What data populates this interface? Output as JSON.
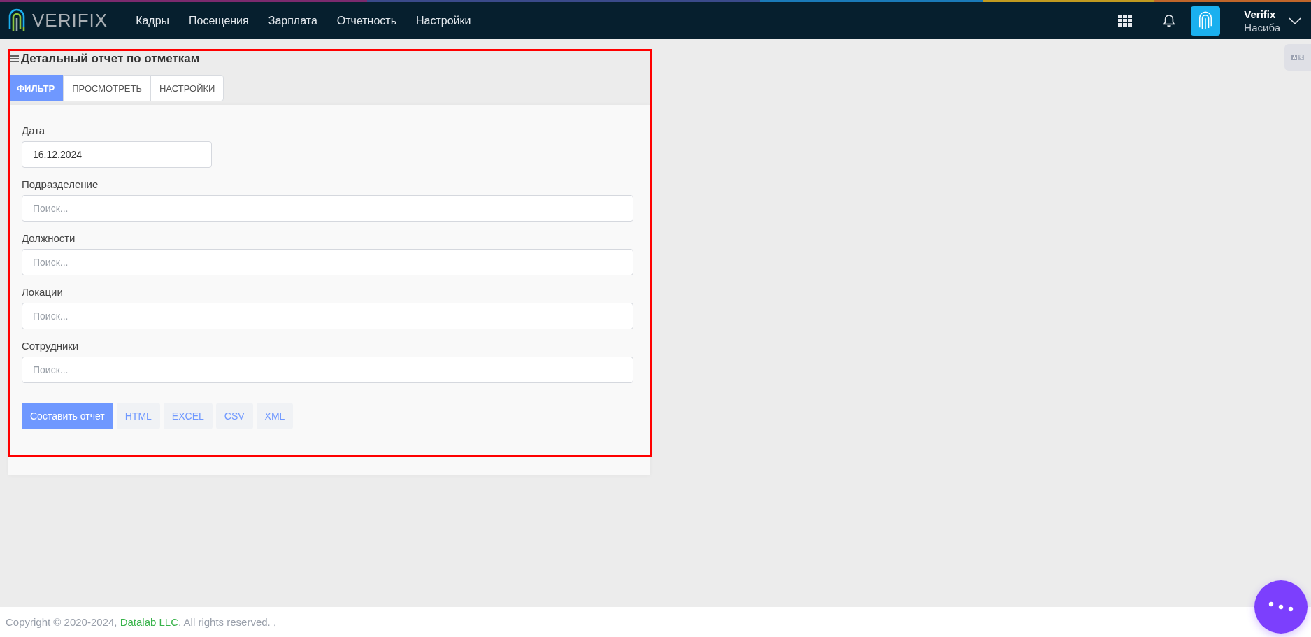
{
  "header": {
    "logo_text": "VERIFIX",
    "nav": [
      "Кадры",
      "Посещения",
      "Зарплата",
      "Отчетность",
      "Настройки"
    ],
    "user": {
      "name": "Verifix",
      "subname": "Насиба"
    }
  },
  "page": {
    "title": "Детальный отчет по отметкам",
    "tabs": [
      {
        "label": "ФИЛЬТР",
        "selected": true
      },
      {
        "label": "ПРОСМОТРЕТЬ",
        "selected": false
      },
      {
        "label": "НАСТРОЙКИ",
        "selected": false
      }
    ],
    "fields": [
      {
        "kind": "date",
        "label": "Дата",
        "value": "16.12.2024"
      },
      {
        "kind": "search",
        "label": "Подразделение",
        "placeholder": "Поиск..."
      },
      {
        "kind": "search",
        "label": "Должности",
        "placeholder": "Поиск..."
      },
      {
        "kind": "search",
        "label": "Локации",
        "placeholder": "Поиск..."
      },
      {
        "kind": "search",
        "label": "Сотрудники",
        "placeholder": "Поиск..."
      }
    ],
    "buttons": [
      {
        "kind": "primary",
        "label": "Составить отчет"
      },
      {
        "kind": "export",
        "label": "HTML"
      },
      {
        "kind": "export",
        "label": "EXCEL"
      },
      {
        "kind": "export",
        "label": "CSV"
      },
      {
        "kind": "export",
        "label": "XML"
      }
    ]
  },
  "footer": {
    "prefix": "Copyright © 2020-2024, ",
    "link": "Datalab LLC",
    "suffix": ". All rights reserved. ,"
  }
}
